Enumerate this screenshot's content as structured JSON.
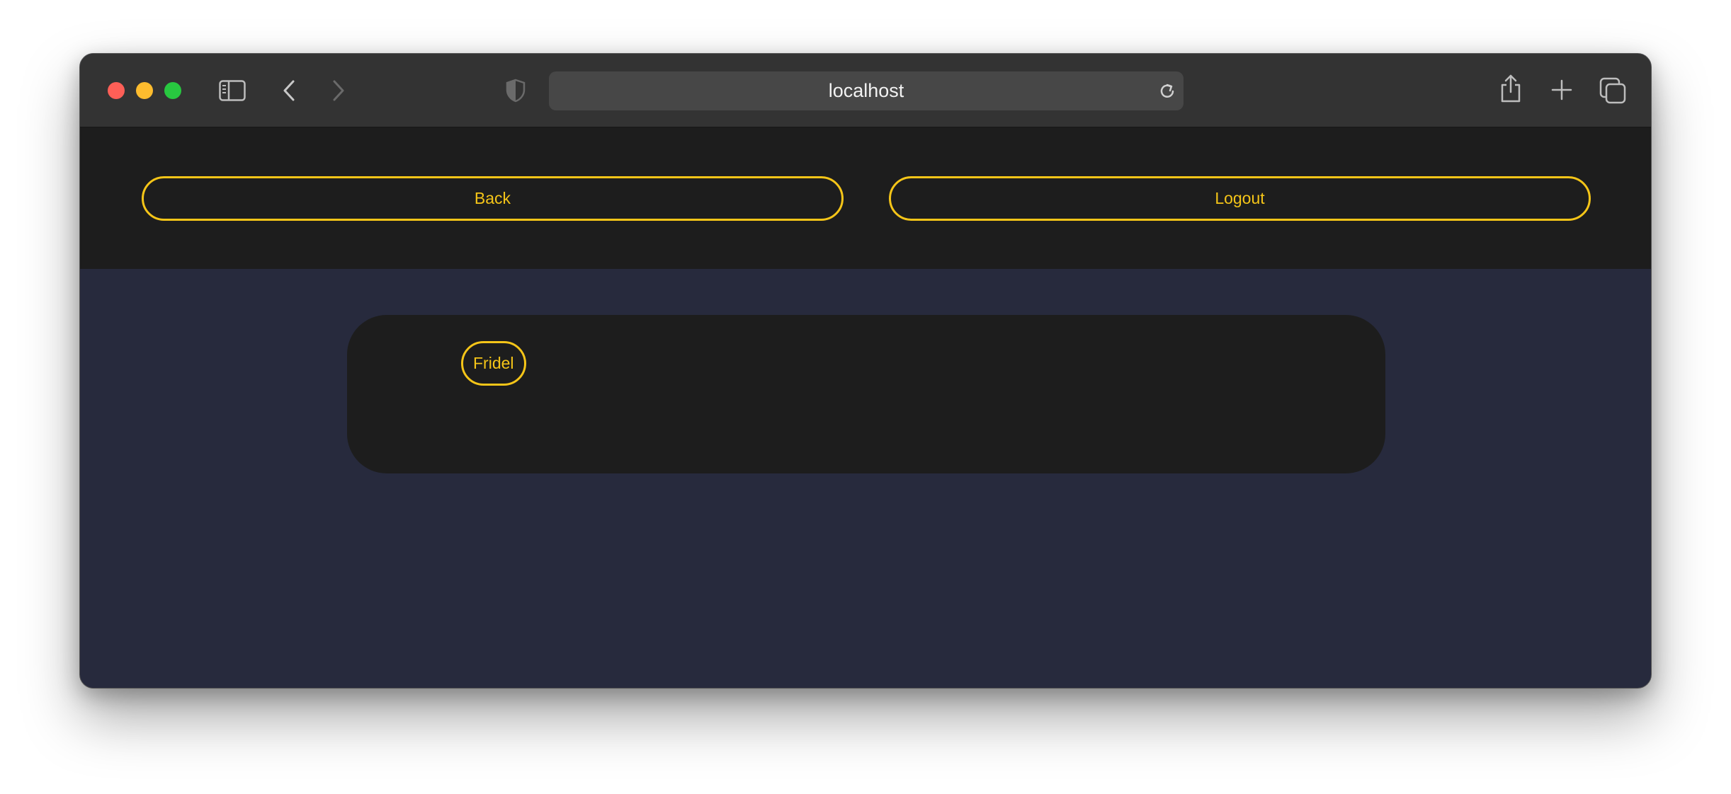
{
  "browser": {
    "url": "localhost"
  },
  "nav": {
    "back_label": "Back",
    "logout_label": "Logout"
  },
  "card": {
    "chip_label": "Fridel"
  },
  "colors": {
    "accent": "#f5c518",
    "page_bg": "#272a3d",
    "panel_bg": "#1d1d1d",
    "chrome_bg": "#333333"
  },
  "icons": [
    "sidebar-icon",
    "chevron-left-icon",
    "chevron-right-icon",
    "shield-icon",
    "reload-icon",
    "share-icon",
    "plus-icon",
    "tabs-icon"
  ]
}
